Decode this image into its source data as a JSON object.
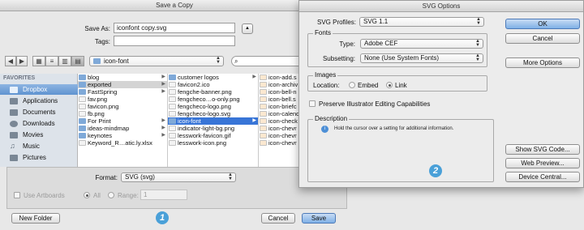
{
  "save_dialog": {
    "title": "Save a Copy",
    "save_as_label": "Save As:",
    "save_as_value": "iconfont copy.svg",
    "tags_label": "Tags:",
    "expand_icon": "▲",
    "location_folder": "icon-font",
    "search_icon": "⌕",
    "sidebar": {
      "header": "FAVORITES",
      "items": [
        {
          "label": "Dropbox",
          "selected": true
        },
        {
          "label": "Applications"
        },
        {
          "label": "Documents"
        },
        {
          "label": "Downloads"
        },
        {
          "label": "Movies"
        },
        {
          "label": "Music"
        },
        {
          "label": "Pictures"
        }
      ]
    },
    "columns": [
      [
        "blog",
        "exported",
        "FastSpring",
        "fav.png",
        "favicon.png",
        "fb.png",
        "For Print",
        "ideas-mindmap",
        "keynotes",
        "Keyword_R…atic.ly.xlsx"
      ],
      [
        "customer logos",
        "favicon2.ico",
        "fengche-banner.png",
        "fengcheco…o-only.png",
        "fengcheco-logo.png",
        "fengcheco-logo.svg",
        "icon-font",
        "indicator-light-bg.png",
        "lesswork-favicon.gif",
        "lesswork-icon.png"
      ],
      [
        "icon-add.s",
        "icon-archiv",
        "icon-bell-n",
        "icon-bell.s",
        "icon-briefc",
        "icon-calend",
        "icon-check",
        "icon-chevr",
        "icon-chevr",
        "icon-chevr"
      ]
    ],
    "format_label": "Format:",
    "format_value": "SVG (svg)",
    "use_artboards_label": "Use Artboards",
    "all_label": "All",
    "range_label": "Range:",
    "range_value": "1",
    "new_folder_label": "New Folder",
    "cancel_label": "Cancel",
    "save_label": "Save",
    "marker": "1"
  },
  "svg_dialog": {
    "title": "SVG Options",
    "profiles_label": "SVG Profiles:",
    "profiles_value": "SVG 1.1",
    "fonts_group": "Fonts",
    "type_label": "Type:",
    "type_value": "Adobe CEF",
    "subsetting_label": "Subsetting:",
    "subsetting_value": "None (Use System Fonts)",
    "images_group": "Images",
    "location_label": "Location:",
    "embed_label": "Embed",
    "link_label": "Link",
    "location_selected": "Link",
    "preserve_label": "Preserve Illustrator Editing Capabilities",
    "description_group": "Description",
    "description_text": "Hold the cursor over a setting for additional information.",
    "ok_label": "OK",
    "cancel_label": "Cancel",
    "more_options_label": "More Options",
    "show_code_label": "Show SVG Code...",
    "web_preview_label": "Web Preview...",
    "device_central_label": "Device Central...",
    "marker": "2"
  }
}
